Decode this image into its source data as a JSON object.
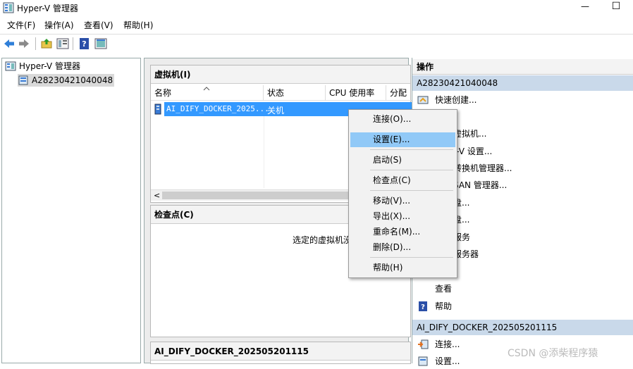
{
  "window": {
    "title": "Hyper-V 管理器",
    "minimize": "—",
    "maximize": "☐"
  },
  "menubar": {
    "items": [
      "文件(F)",
      "操作(A)",
      "查看(V)",
      "帮助(H)"
    ]
  },
  "toolbar": {
    "icons": [
      "back-arrow-icon",
      "forward-arrow-icon",
      "folder-up-icon",
      "show-tree-icon",
      "help-icon",
      "console-icon"
    ]
  },
  "tree": {
    "root": "Hyper-V 管理器",
    "server": "A28230421040048"
  },
  "vm_panel": {
    "title": "虚拟机(I)",
    "columns": [
      "名称",
      "状态",
      "CPU 使用率",
      "分配"
    ],
    "rows": [
      {
        "name": "AI_DIFY_DOCKER_2025...",
        "state": "关机",
        "cpu": ""
      }
    ],
    "scroll_left": "<"
  },
  "checkpoint_panel": {
    "title": "检查点(C)",
    "message": "选定的虚拟机没"
  },
  "detail_panel": {
    "title": "AI_DIFY_DOCKER_202505201115"
  },
  "actions": {
    "header": "操作",
    "server_section": "A28230421040048",
    "server_items": [
      "快速创建...",
      "虚拟机...",
      "r-V 设置...",
      "转换机管理器...",
      "SAN 管理器...",
      "盘...",
      "盘...",
      "服务",
      "服务器",
      "",
      "查看",
      "帮助"
    ],
    "vm_section": "AI_DIFY_DOCKER_202505201115",
    "vm_items": [
      "连接...",
      "设置..."
    ]
  },
  "context_menu": {
    "items": [
      "连接(O)...",
      "设置(E)...",
      "启动(S)",
      "检查点(C)",
      "移动(V)...",
      "导出(X)...",
      "重命名(M)...",
      "删除(D)...",
      "帮助(H)"
    ],
    "highlighted_index": 1
  },
  "watermark": "CSDN @添柴程序猿",
  "colors": {
    "selection": "#3399ff",
    "section_band": "#c9d9ea",
    "menu_highlight": "#91c9f7"
  }
}
